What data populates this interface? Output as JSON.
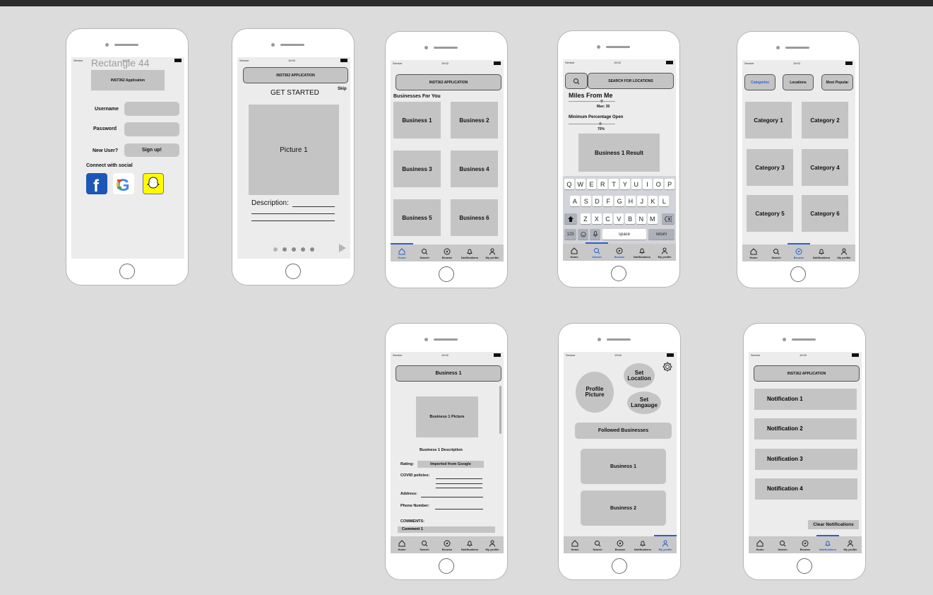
{
  "status": {
    "carrier": "Service",
    "time": "19:02"
  },
  "tabs": [
    "Home",
    "Search",
    "Browse",
    "Notifications",
    "My profile"
  ],
  "app_title": "INST362 APPLICATION",
  "login": {
    "frame_label": "Rectangle 44",
    "logo": "INST362 Application",
    "username": "Username",
    "password": "Password",
    "new_user": "New User?",
    "signup": "Sign up!",
    "social": "Connect with social"
  },
  "onboarding": {
    "title": "GET STARTED",
    "skip": "Skip",
    "picture": "Picture 1",
    "description": "Description:"
  },
  "home": {
    "heading": "Businesses For You",
    "businesses": [
      "Business 1",
      "Business 2",
      "Business 3",
      "Business 4",
      "Business 5",
      "Business 6"
    ]
  },
  "search": {
    "placeholder": "SEARCH FOR LOCATIONS",
    "miles": "Miles From Me",
    "max": "Max: 30",
    "min_open": "Minimum Percentage Open",
    "pct": "70%",
    "result": "Business 1 Result",
    "keys_row1": [
      "Q",
      "W",
      "E",
      "R",
      "T",
      "Y",
      "U",
      "I",
      "O",
      "P"
    ],
    "keys_row2": [
      "A",
      "S",
      "D",
      "F",
      "G",
      "H",
      "J",
      "K",
      "L"
    ],
    "keys_row3": [
      "Z",
      "X",
      "C",
      "V",
      "B",
      "N",
      "M"
    ],
    "key_123": "123",
    "key_space": "space",
    "key_return": "return"
  },
  "browse": {
    "filters": [
      "Categories",
      "Locations",
      "Most Popular"
    ],
    "categories": [
      "Category 1",
      "Category 2",
      "Category 3",
      "Category 4",
      "Category 5",
      "Category 6"
    ]
  },
  "business": {
    "title": "Business 1",
    "picture": "Business 1 Picture",
    "description": "Business 1 Description",
    "rating": "Rating:",
    "rating_value": "Imported from Google",
    "covid": "COVID policies:",
    "address": "Address:",
    "phone": "Phone Number:",
    "comments": "COMMENTS:",
    "comment1": "Comment 1"
  },
  "profile": {
    "picture": "Profile Picture",
    "set_location": "Set Location",
    "set_language": "Set Langauge",
    "followed": "Followed Businesses",
    "biz1": "Business 1",
    "biz2": "Business 2"
  },
  "notifications": {
    "items": [
      "Notification 1",
      "Notification 2",
      "Notification 3",
      "Notification 4"
    ],
    "clear": "Clear Notifications"
  }
}
